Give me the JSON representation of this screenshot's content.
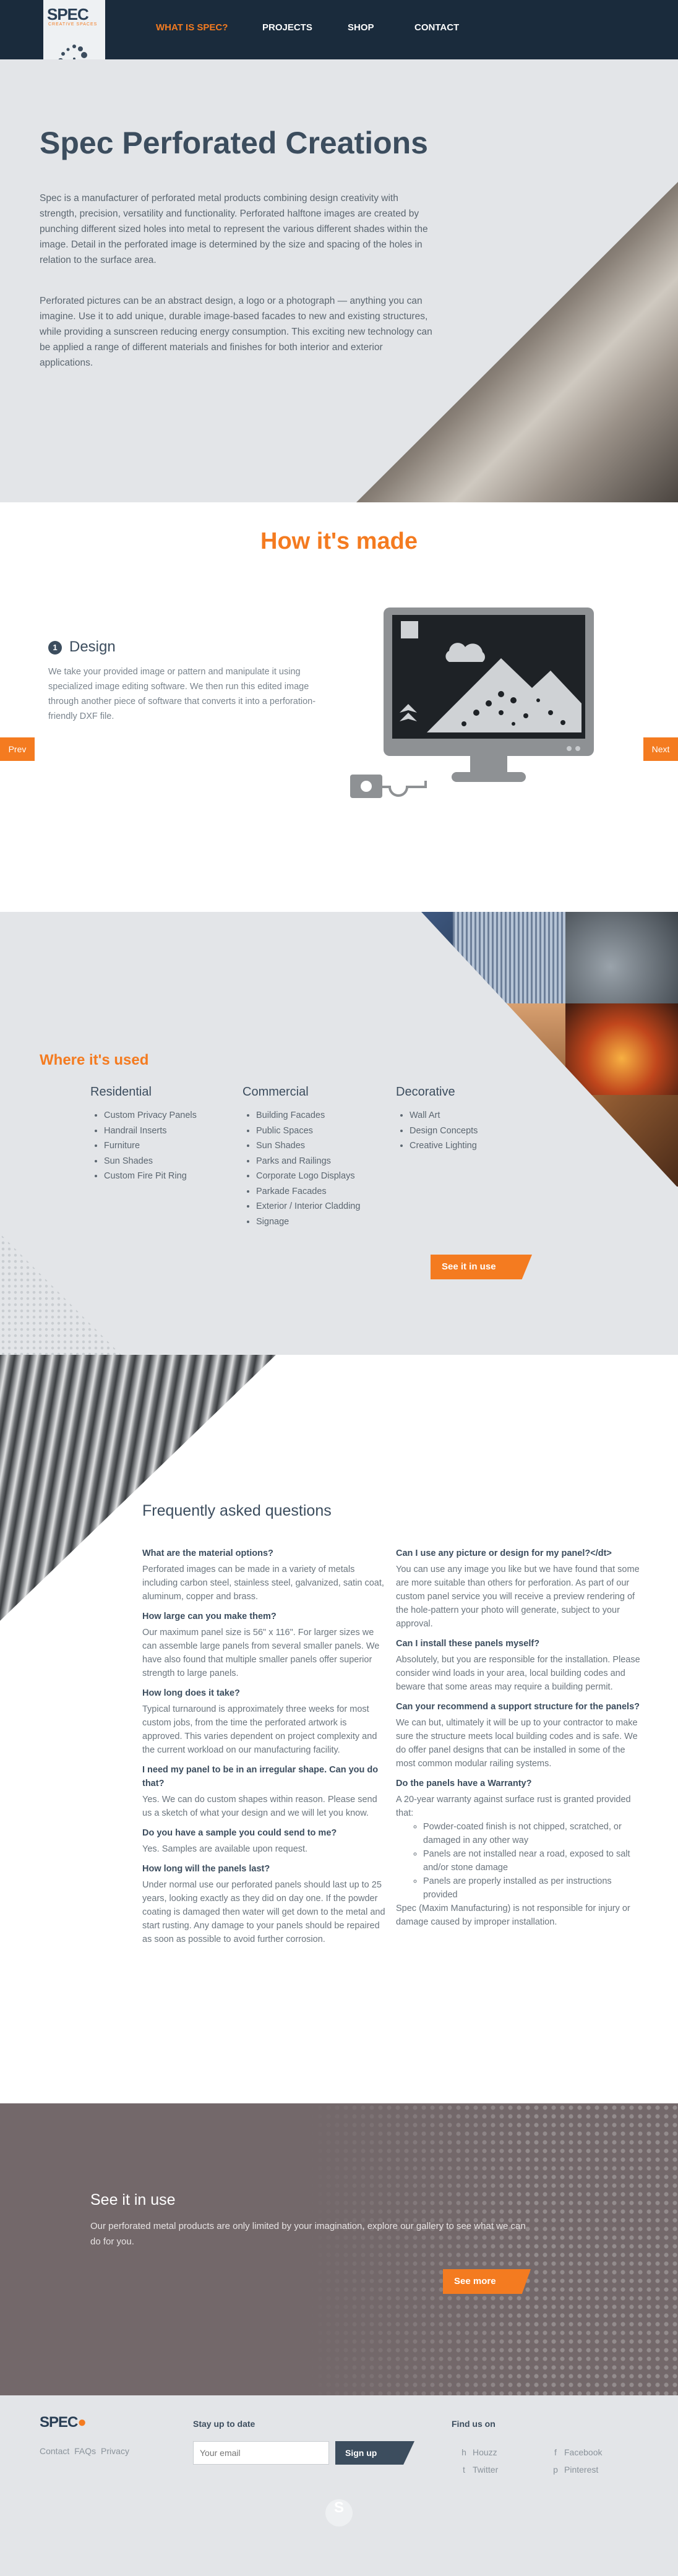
{
  "nav": {
    "logo": "SPEC",
    "logo_tagline": "CREATIVE SPACES",
    "links": [
      "WHAT IS SPEC?",
      "PROJECTS",
      "SHOP",
      "CONTACT"
    ]
  },
  "hero": {
    "title": "Spec Perforated Creations",
    "paragraphs": [
      "Spec is a manufacturer of perforated metal products combining design creativity with strength, precision, versatility and functionality. Perforated halftone images are created by punching different sized holes into metal to represent the various different shades within the image. Detail in the perforated image is determined by the size and spacing of the holes in relation to the surface area.",
      "Perforated pictures can be an abstract design, a logo or a photograph — anything you can imagine. Use it to add unique, durable image-based facades to new and existing structures, while providing a sunscreen reducing energy consumption. This exciting new technology can be applied a range of different materials and finishes for both interior and exterior applications."
    ]
  },
  "how": {
    "title": "How it's made",
    "step_number": "1",
    "step_title": "Design",
    "step_text": "We take your provided image or pattern and manipulate it using specialized image editing software. We then run this edited image through another piece of software that converts it into a perforation-friendly DXF file.",
    "prev": "Prev",
    "next": "Next"
  },
  "where": {
    "title": "Where it's used",
    "columns": [
      {
        "heading": "Residential",
        "items": [
          "Custom Privacy Panels",
          "Handrail Inserts",
          "Furniture",
          "Sun Shades",
          "Custom Fire Pit Ring"
        ]
      },
      {
        "heading": "Commercial",
        "items": [
          "Building Facades",
          "Public Spaces",
          "Sun Shades",
          "Parks and Railings",
          "Corporate Logo Displays",
          "Parkade Facades",
          "Exterior / Interior Cladding",
          "Signage"
        ]
      },
      {
        "heading": "Decorative",
        "items": [
          "Wall Art",
          "Design Concepts",
          "Creative Lighting"
        ]
      }
    ],
    "cta": "See it in use"
  },
  "faq": {
    "title": "Frequently asked questions",
    "left": [
      {
        "q": "What are the material options?",
        "a": "Perforated images can be made in a variety of metals including carbon steel, stainless steel, galvanized, satin coat, aluminum, copper and brass."
      },
      {
        "q": "How large can you make them?",
        "a": "Our maximum panel size is 56\" x 116\". For larger sizes we can assemble large panels from several smaller panels. We have also found that multiple smaller panels offer superior strength to large panels."
      },
      {
        "q": "How long does it take?",
        "a": "Typical turnaround is approximately three weeks for most custom jobs, from the time the perforated artwork is approved. This varies dependent on project complexity and the current workload on our manufacturing facility."
      },
      {
        "q": "I need my panel to be in an irregular shape. Can you do that?",
        "a": "Yes. We can do custom shapes within reason. Please send us a sketch of what your design and we will let you know."
      },
      {
        "q": "Do you have a sample you could send to me?",
        "a": "Yes. Samples are available upon request."
      },
      {
        "q": "How long will the panels last?",
        "a": "Under normal use our perforated panels should last up to 25 years, looking exactly as they did on day one. If the powder coating is damaged then water will get down to the metal and start rusting. Any damage to your panels should be repaired as soon as possible to avoid further corrosion."
      }
    ],
    "right": {
      "q1": "Can I use any picture or design for my panel?</dt>",
      "a1": "You can use any image you like but we have found that some are more suitable than others for perforation. As part of our custom panel service you will receive a preview rendering of the hole-pattern your photo will generate, subject to your approval.",
      "q2": "Can I install these panels myself?",
      "a2": "Absolutely, but you are responsible for the installation. Please consider wind loads in your area, local building codes and beware that some areas may require a building permit.",
      "q3": "Can your recommend a support structure for the panels?",
      "a3": "We can but, ultimately it will be up to your contractor to make sure the structure meets local building codes and is safe. We do offer panel designs that can be installed in some of the most common modular railing systems.",
      "q4": "Do the panels have a Warranty?",
      "a4": "A 20-year warranty against surface rust is granted provided that:",
      "bullets": [
        "Powder-coated finish is not chipped, scratched, or damaged in any other way",
        "Panels are not installed near a road, exposed to salt and/or stone damage",
        "Panels are properly installed as per instructions provided"
      ],
      "a4b": "Spec (Maxim Manufacturing) is not responsible for injury or damage caused by improper installation."
    }
  },
  "seeit": {
    "title": "See it in use",
    "text": "Our perforated metal products are only limited by your imagination, explore our gallery to see what we can do for you.",
    "cta": "See more"
  },
  "footer": {
    "logo": "SPEC",
    "links": [
      "Contact",
      "FAQs",
      "Privacy"
    ],
    "stay_title": "Stay up to date",
    "email_placeholder": "Your email",
    "signup": "Sign up",
    "find_title": "Find us on",
    "social": [
      "Houzz",
      "Facebook",
      "Twitter",
      "Pinterest"
    ]
  },
  "colors": {
    "accent": "#f47b20",
    "navy": "#1a2b3c",
    "slate": "#3c4d5e"
  }
}
